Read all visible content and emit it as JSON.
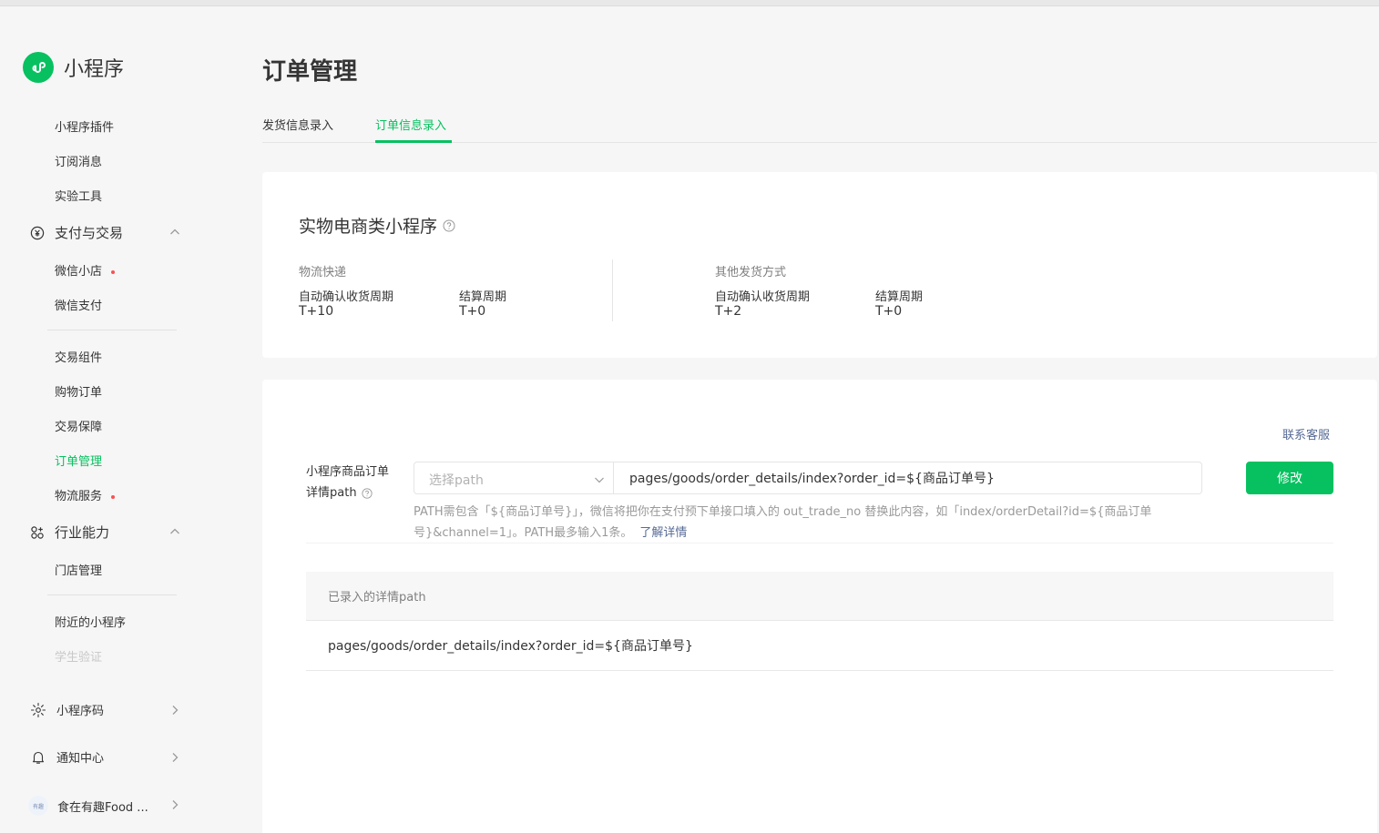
{
  "app": {
    "name": "小程序"
  },
  "sidebar": {
    "items_top": [
      {
        "label": "小程序插件"
      },
      {
        "label": "订阅消息"
      },
      {
        "label": "实验工具"
      }
    ],
    "group_pay": {
      "label": "支付与交易"
    },
    "pay_items": [
      {
        "label": "微信小店",
        "dot": true
      },
      {
        "label": "微信支付"
      }
    ],
    "trade_items": [
      {
        "label": "交易组件"
      },
      {
        "label": "购物订单"
      },
      {
        "label": "交易保障"
      },
      {
        "label": "订单管理",
        "active": true
      },
      {
        "label": "物流服务",
        "dot": true
      }
    ],
    "group_industry": {
      "label": "行业能力"
    },
    "industry_items": [
      {
        "label": "门店管理"
      },
      {
        "label": "附近的小程序"
      },
      {
        "label": "学生验证"
      }
    ],
    "bottom": [
      {
        "label": "小程序码"
      },
      {
        "label": "通知中心"
      },
      {
        "label": "食在有趣Food ..."
      }
    ],
    "avatar_text": "有趣"
  },
  "page": {
    "title": "订单管理",
    "tabs": [
      {
        "label": "发货信息录入"
      },
      {
        "label": "订单信息录入",
        "active": true
      }
    ]
  },
  "summary": {
    "title": "实物电商类小程序",
    "sections": [
      {
        "label": "物流快递",
        "confirm_label": "自动确认收货周期",
        "confirm_value": "T+10",
        "settle_label": "结算周期",
        "settle_value": "T+0"
      },
      {
        "label": "其他发货方式",
        "confirm_label": "自动确认收货周期",
        "confirm_value": "T+2",
        "settle_label": "结算周期",
        "settle_value": "T+0"
      }
    ]
  },
  "path_form": {
    "contact_link": "联系客服",
    "label_line1": "小程序商品订单",
    "label_line2": "详情path",
    "select_placeholder": "选择path",
    "input_value": "pages/goods/order_details/index?order_id=${商品订单号}",
    "edit_button": "修改",
    "hint": "PATH需包含「${商品订单号}」，微信将把你在支付预下单接口填入的 out_trade_no 替换此内容，如「index/orderDetail?id=${商品订单号}&channel=1」。PATH最多输入1条。",
    "hint_link": "了解详情"
  },
  "path_table": {
    "header": "已录入的详情path",
    "rows": [
      {
        "path": "pages/goods/order_details/index?order_id=${商品订单号}"
      }
    ]
  },
  "colors": {
    "brand": "#07c160",
    "link": "#576b95",
    "dot": "#fa5151"
  }
}
